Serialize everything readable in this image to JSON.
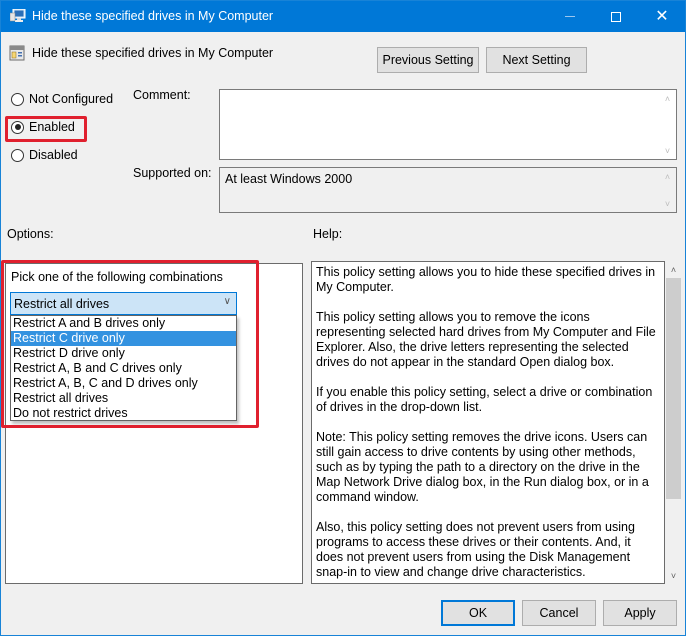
{
  "window": {
    "title": "Hide these specified drives in My Computer",
    "icon": "computer-policy-icon",
    "controls": {
      "minimize": "minimize-icon",
      "maximize": "maximize-icon",
      "close": "close-icon"
    },
    "accent_color": "#0078d7"
  },
  "header": {
    "policy_title": "Hide these specified drives in My Computer",
    "policy_icon": "policy-setting-icon",
    "previous_label": "Previous Setting",
    "next_label": "Next Setting"
  },
  "state": {
    "options": [
      {
        "label": "Not Configured",
        "checked": false
      },
      {
        "label": "Enabled",
        "checked": true
      },
      {
        "label": "Disabled",
        "checked": false
      }
    ],
    "highlight_color": "#e0202e"
  },
  "comment": {
    "label": "Comment:",
    "value": ""
  },
  "supported": {
    "label": "Supported on:",
    "value": "At least Windows 2000"
  },
  "options_section": {
    "label": "Options:",
    "pick_label": "Pick one of the following combinations",
    "combo_value": "Restrict all drives",
    "dropdown_items": [
      "Restrict A and B drives only",
      "Restrict C drive only",
      "Restrict D drive only",
      "Restrict A, B and C drives only",
      "Restrict A, B, C and D drives only",
      "Restrict all drives",
      "Do not restrict drives"
    ],
    "hovered_item": "Restrict C drive only"
  },
  "help_section": {
    "label": "Help:",
    "paragraphs": [
      "This policy setting allows you to hide these specified drives in My Computer.",
      "This policy setting allows you to remove the icons representing selected hard drives from My Computer and File Explorer. Also, the drive letters representing the selected drives do not appear in the standard Open dialog box.",
      "If you enable this policy setting, select a drive or combination of drives in the drop-down list.",
      "Note: This policy setting removes the drive icons. Users can still gain access to drive contents by using other methods, such as by typing the path to a directory on the drive in the Map Network Drive dialog box, in the Run dialog box, or in a command window.",
      "Also, this policy setting does not prevent users from using programs to access these drives or their contents. And, it does not prevent users from using the Disk Management snap-in to view and change drive characteristics."
    ]
  },
  "footer": {
    "ok_label": "OK",
    "cancel_label": "Cancel",
    "apply_label": "Apply"
  }
}
